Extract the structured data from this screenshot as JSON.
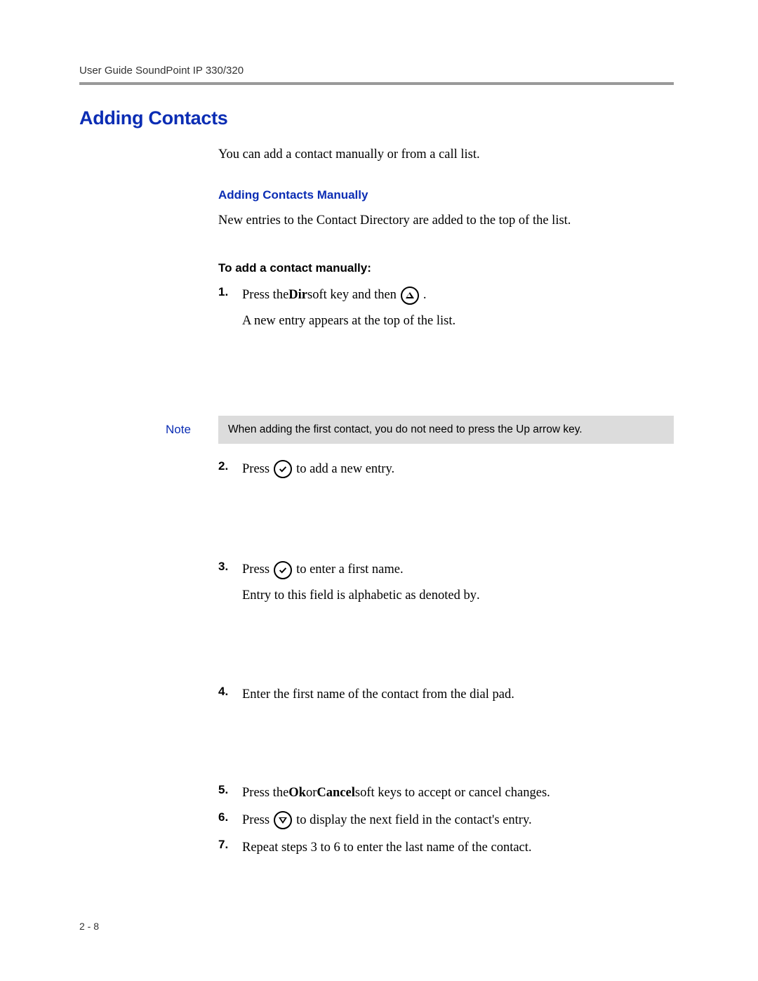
{
  "header": "User Guide SoundPoint IP 330/320",
  "title": "Adding Contacts",
  "intro": "You can add a contact manually or from a call list.",
  "subHeadingBlue": "Adding Contacts Manually",
  "subBlueText": "New entries to the Contact Directory are added to the top of the list.",
  "subHeadingBlack": "To add a contact manually:",
  "step1": {
    "num": "1.",
    "pre": "Press the ",
    "bold": "Dir",
    "mid": " soft key and then  ",
    "post": " .",
    "line2": "A new entry appears at the top of the list."
  },
  "note": {
    "label": "Note",
    "text": "When adding the first contact, you do not need to press the Up arrow key."
  },
  "step2": {
    "num": "2.",
    "pre": "Press  ",
    "post": "  to add a new entry."
  },
  "step3": {
    "num": "3.",
    "pre": "Press  ",
    "post": "  to enter a first name.",
    "line2pre": "Entry to this field is alphabetic as denoted by ",
    "line2post": "     ."
  },
  "step4": {
    "num": "4.",
    "text": "Enter the first name of the contact from the dial pad."
  },
  "step5": {
    "num": "5.",
    "pre": "Press the ",
    "bold1": "Ok",
    "mid": " or ",
    "bold2": "Cancel",
    "post": " soft keys to accept or cancel changes."
  },
  "step6": {
    "num": "6.",
    "pre": "Press   ",
    "post": "   to display the next field in the contact's entry."
  },
  "step7": {
    "num": "7.",
    "text": "Repeat steps 3 to 6 to enter the last name of the contact."
  },
  "footer": "2 - 8"
}
